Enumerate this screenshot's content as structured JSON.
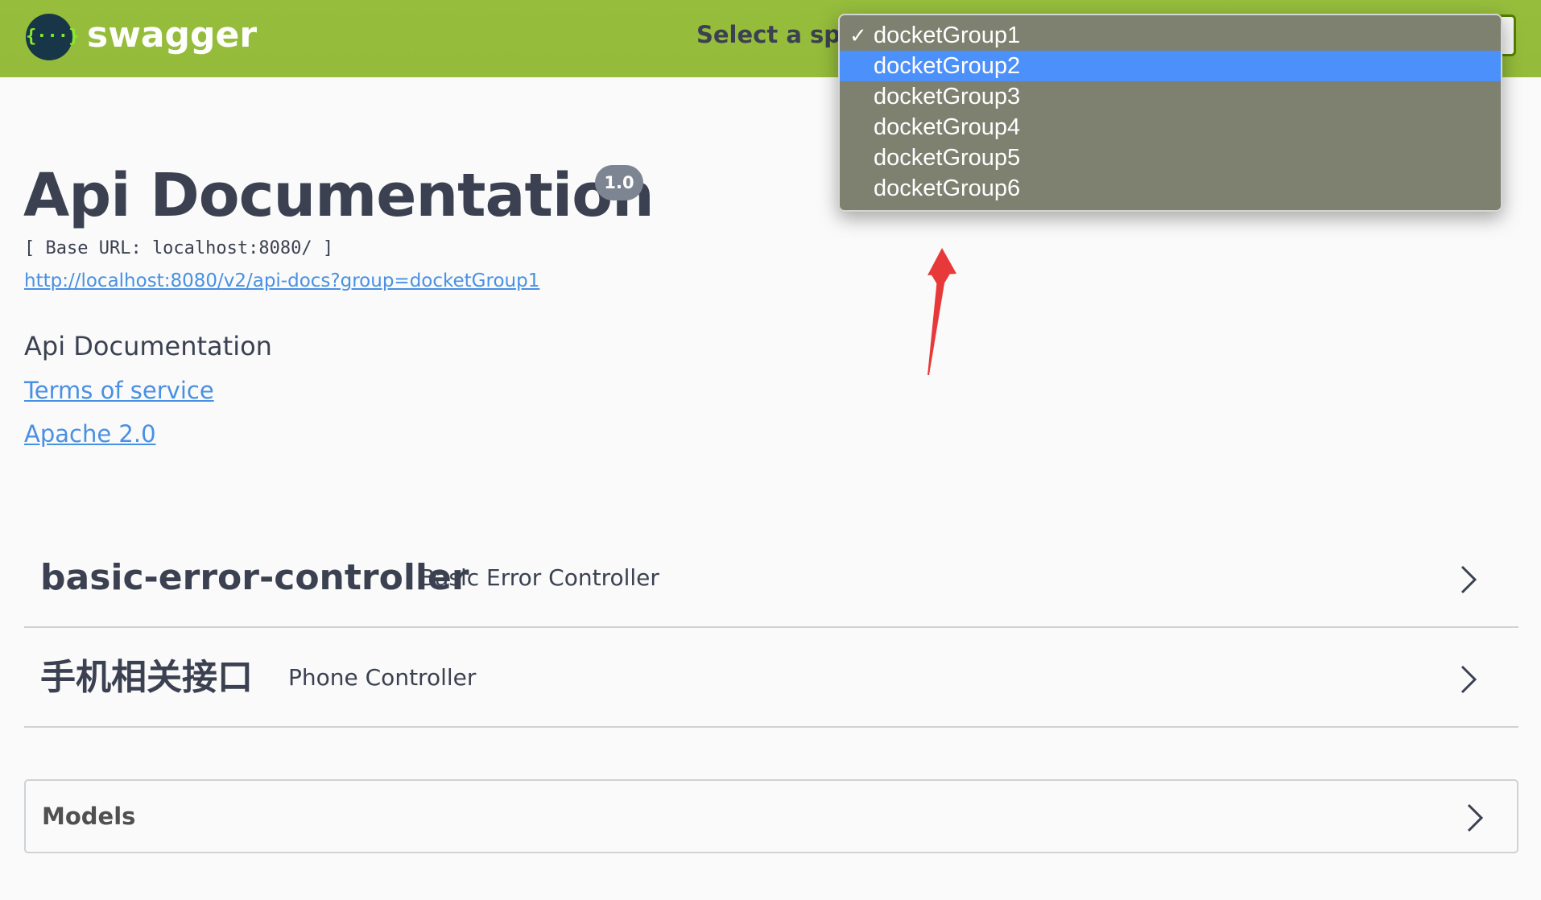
{
  "topbar": {
    "logo_glyph": "{···}",
    "brand": "swagger",
    "spec_label": "Select a spec"
  },
  "spec_dropdown": {
    "selected": "docketGroup1",
    "highlighted": "docketGroup2",
    "check": "✓",
    "options": [
      "docketGroup1",
      "docketGroup2",
      "docketGroup3",
      "docketGroup4",
      "docketGroup5",
      "docketGroup6"
    ]
  },
  "info": {
    "title": "Api Documentation",
    "version": "1.0",
    "base_url": "[ Base URL: localhost:8080/ ]",
    "api_docs_url": "http://localhost:8080/v2/api-docs?group=docketGroup1",
    "description": "Api Documentation",
    "terms_of_service": "Terms of service",
    "license": "Apache 2.0"
  },
  "tags": [
    {
      "name": "basic-error-controller",
      "description": "Basic Error Controller"
    },
    {
      "name": "手机相关接口",
      "description": "Phone Controller"
    }
  ],
  "models": {
    "label": "Models"
  },
  "annotation": {
    "color": "#e8393a",
    "icon": "red-arrow-icon"
  }
}
